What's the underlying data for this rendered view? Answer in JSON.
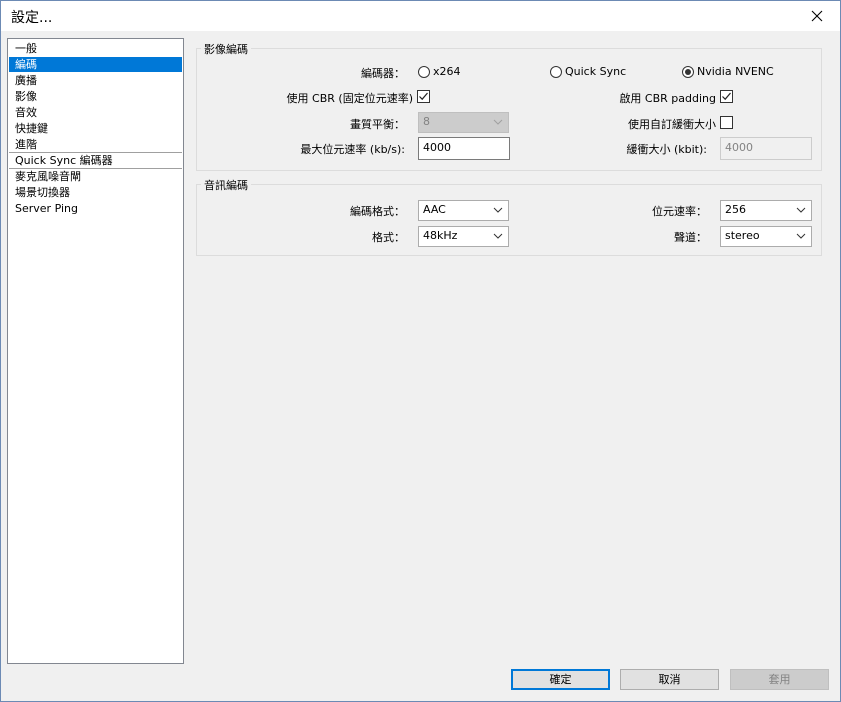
{
  "window": {
    "title": "設定...",
    "close_icon": "close-icon"
  },
  "sidebar": {
    "items": [
      {
        "label": "一般"
      },
      {
        "label": "編碼",
        "selected": true
      },
      {
        "label": "廣播"
      },
      {
        "label": "影像"
      },
      {
        "label": "音效"
      },
      {
        "label": "快捷鍵"
      },
      {
        "label": "進階"
      },
      {
        "label": "Quick Sync 編碼器"
      },
      {
        "label": "麥克風噪音閘"
      },
      {
        "label": "場景切換器"
      },
      {
        "label": "Server Ping"
      }
    ]
  },
  "video_encoding": {
    "title": "影像編碼",
    "encoder_label": "編碼器：",
    "encoder_options": [
      "x264",
      "Quick Sync",
      "Nvidia NVENC"
    ],
    "encoder_selected": "Nvidia NVENC",
    "use_cbr_label": "使用 CBR (固定位元速率)",
    "use_cbr_checked": true,
    "cbr_padding_label": "啟用 CBR padding",
    "cbr_padding_checked": true,
    "quality_label": "畫質平衡：",
    "quality_value": "8",
    "custom_buffer_label": "使用自訂緩衝大小",
    "custom_buffer_checked": false,
    "max_bitrate_label": "最大位元速率 (kb/s):",
    "max_bitrate_value": "4000",
    "buffer_size_label": "緩衝大小 (kbit):",
    "buffer_size_value": "4000"
  },
  "audio_encoding": {
    "title": "音訊編碼",
    "codec_label": "編碼格式：",
    "codec_value": "AAC",
    "bitrate_label": "位元速率：",
    "bitrate_value": "256",
    "format_label": "格式：",
    "format_value": "48kHz",
    "channel_label": "聲道：",
    "channel_value": "stereo"
  },
  "footer": {
    "ok_label": "確定",
    "cancel_label": "取消",
    "apply_label": "套用"
  }
}
